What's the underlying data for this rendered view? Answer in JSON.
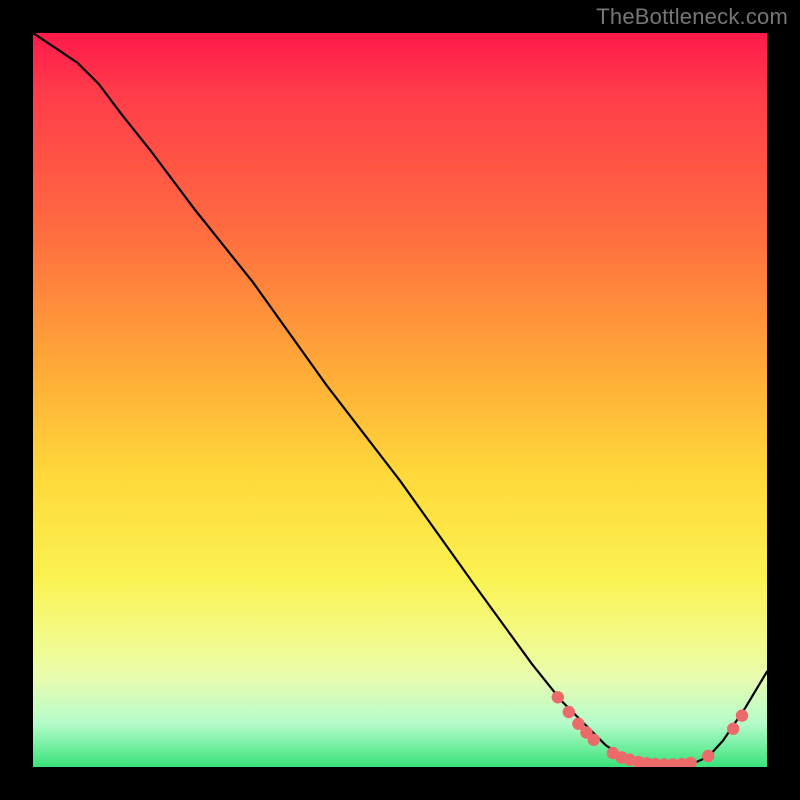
{
  "watermark": "TheBottleneck.com",
  "chart_data": {
    "type": "line",
    "title": "",
    "xlabel": "",
    "ylabel": "",
    "xlim": [
      0,
      100
    ],
    "ylim": [
      0,
      100
    ],
    "grid": false,
    "legend": false,
    "series": [
      {
        "name": "curve",
        "x": [
          0,
          3,
          6,
          9,
          12,
          16,
          22,
          30,
          40,
          50,
          60,
          68,
          72,
          76,
          78,
          80,
          82,
          84,
          86,
          88,
          90,
          92,
          94,
          97,
          100
        ],
        "values": [
          100,
          98,
          96,
          93,
          89,
          84,
          76,
          66,
          52,
          39,
          25,
          14,
          9,
          5,
          3,
          1.6,
          0.9,
          0.5,
          0.3,
          0.3,
          0.5,
          1.4,
          3.6,
          8.0,
          13
        ]
      }
    ],
    "markers": [
      {
        "x": 71.5,
        "y": 9.5
      },
      {
        "x": 73.0,
        "y": 7.5
      },
      {
        "x": 74.3,
        "y": 5.9
      },
      {
        "x": 75.4,
        "y": 4.7
      },
      {
        "x": 76.4,
        "y": 3.7
      },
      {
        "x": 79.0,
        "y": 1.9
      },
      {
        "x": 80.2,
        "y": 1.3
      },
      {
        "x": 81.3,
        "y": 1.0
      },
      {
        "x": 82.5,
        "y": 0.7
      },
      {
        "x": 83.6,
        "y": 0.5
      },
      {
        "x": 84.8,
        "y": 0.4
      },
      {
        "x": 86.0,
        "y": 0.35
      },
      {
        "x": 87.2,
        "y": 0.35
      },
      {
        "x": 88.4,
        "y": 0.4
      },
      {
        "x": 89.6,
        "y": 0.55
      },
      {
        "x": 92.0,
        "y": 1.5
      },
      {
        "x": 95.4,
        "y": 5.2
      },
      {
        "x": 96.6,
        "y": 7.0
      }
    ],
    "background_gradient": {
      "top": "#ff1a4b",
      "mid": "#ffd83a",
      "bottom": "#39e37a"
    }
  }
}
